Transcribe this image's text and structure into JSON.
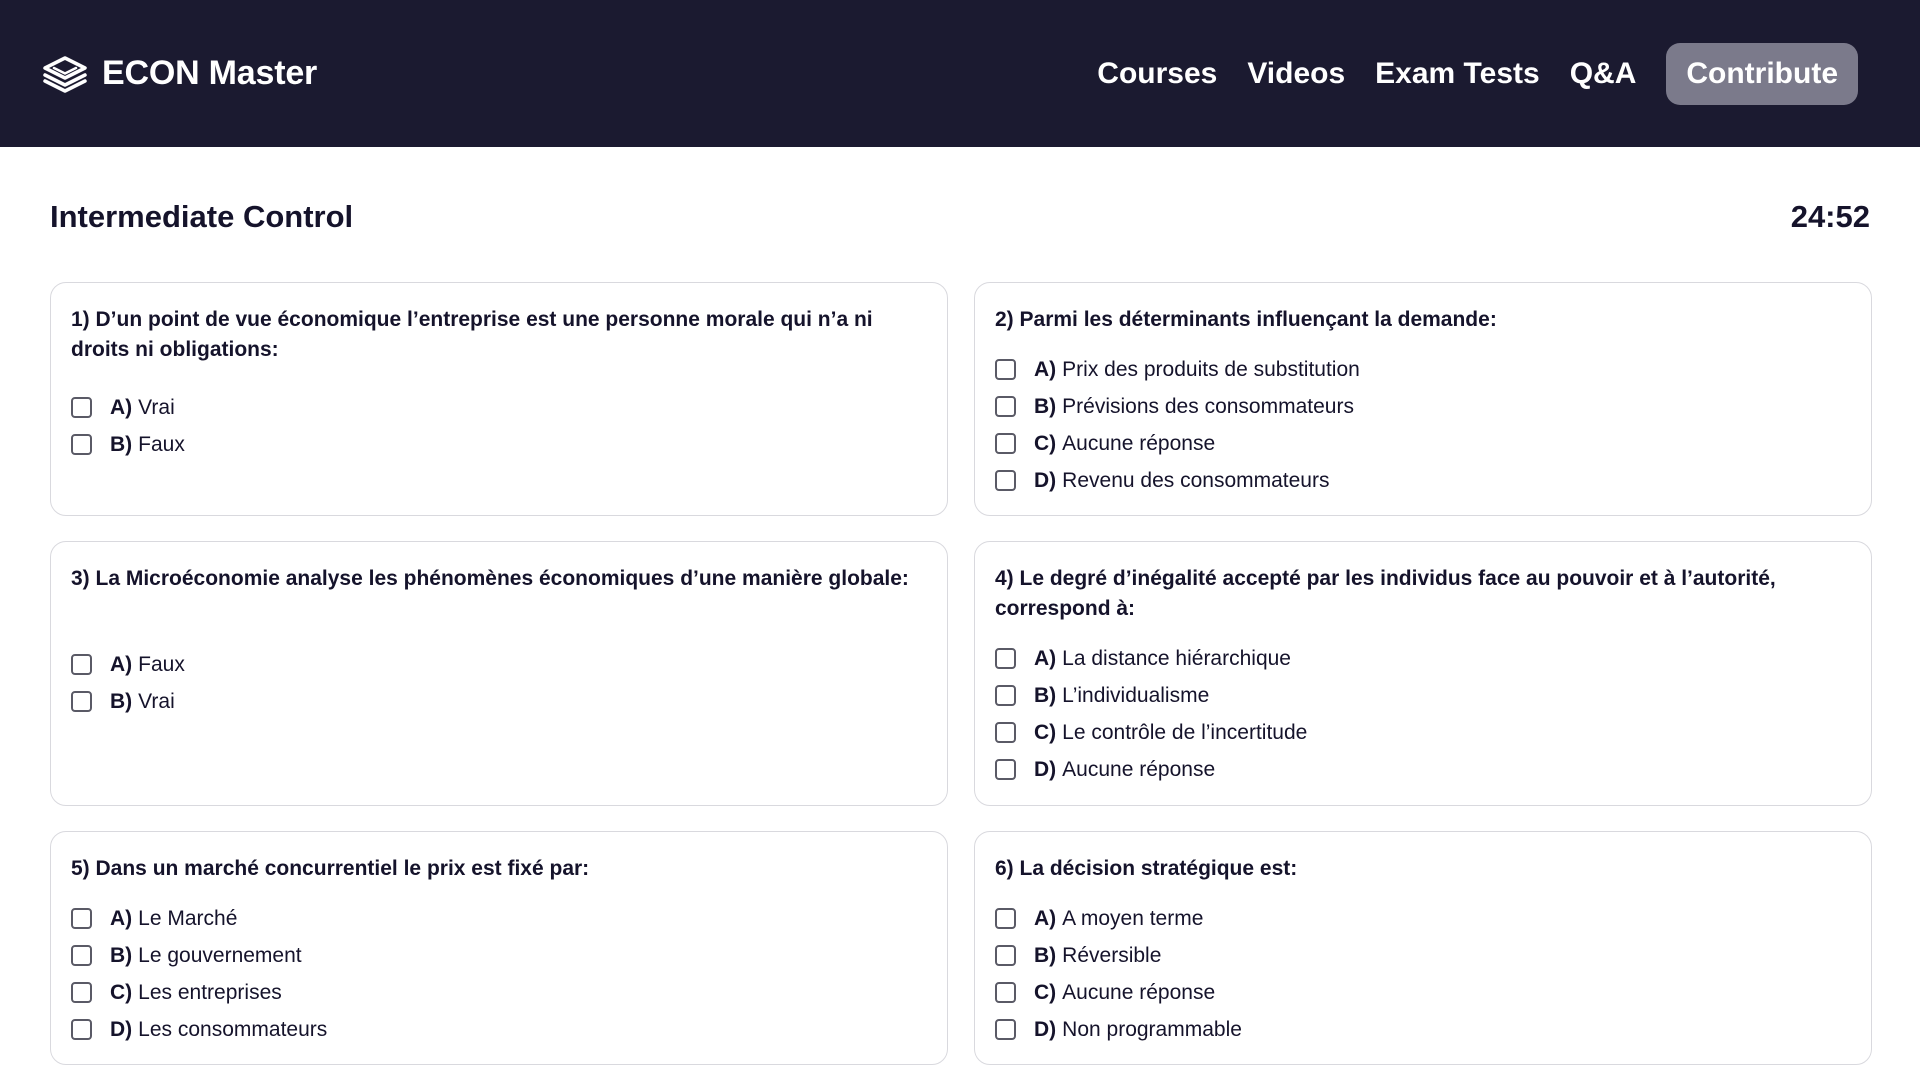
{
  "brand": {
    "name": "ECON Master",
    "icon": "layers-icon"
  },
  "nav": {
    "links": [
      "Courses",
      "Videos",
      "Exam Tests",
      "Q&A"
    ],
    "contribute_label": "Contribute"
  },
  "page": {
    "title": "Intermediate Control",
    "timer": "24:52"
  },
  "questions": [
    {
      "text": "1) D’un point de vue économique l’entreprise est une personne morale qui n’a ni droits ni obligations:",
      "options": [
        {
          "letter": "A)",
          "text": "Vrai"
        },
        {
          "letter": "B)",
          "text": "Faux"
        }
      ]
    },
    {
      "text": "2) Parmi les déterminants influençant la demande:",
      "options": [
        {
          "letter": "A)",
          "text": "Prix des produits de substitution"
        },
        {
          "letter": "B)",
          "text": "Prévisions des consommateurs"
        },
        {
          "letter": "C)",
          "text": "Aucune réponse"
        },
        {
          "letter": "D)",
          "text": "Revenu des consommateurs"
        }
      ]
    },
    {
      "text": "3) La Microéconomie analyse les phénomènes économiques d’une manière globale:",
      "options": [
        {
          "letter": "A)",
          "text": "Faux"
        },
        {
          "letter": "B)",
          "text": "Vrai"
        }
      ]
    },
    {
      "text": "4) Le degré d’inégalité accepté par les individus face au pouvoir et à l’autorité, correspond à:",
      "options": [
        {
          "letter": "A)",
          "text": "La distance hiérarchique"
        },
        {
          "letter": "B)",
          "text": "L’individualisme"
        },
        {
          "letter": "C)",
          "text": "Le contrôle de l’incertitude"
        },
        {
          "letter": "D)",
          "text": "Aucune réponse"
        }
      ]
    },
    {
      "text": "5) Dans un marché concurrentiel le prix est fixé par:",
      "options": [
        {
          "letter": "A)",
          "text": "Le Marché"
        },
        {
          "letter": "B)",
          "text": "Le gouvernement"
        },
        {
          "letter": "C)",
          "text": "Les entreprises"
        },
        {
          "letter": "D)",
          "text": "Les consommateurs"
        }
      ]
    },
    {
      "text": "6) La décision stratégique est:",
      "options": [
        {
          "letter": "A)",
          "text": "A moyen terme"
        },
        {
          "letter": "B)",
          "text": "Réversible"
        },
        {
          "letter": "C)",
          "text": "Aucune réponse"
        },
        {
          "letter": "D)",
          "text": "Non programmable"
        }
      ]
    }
  ]
}
